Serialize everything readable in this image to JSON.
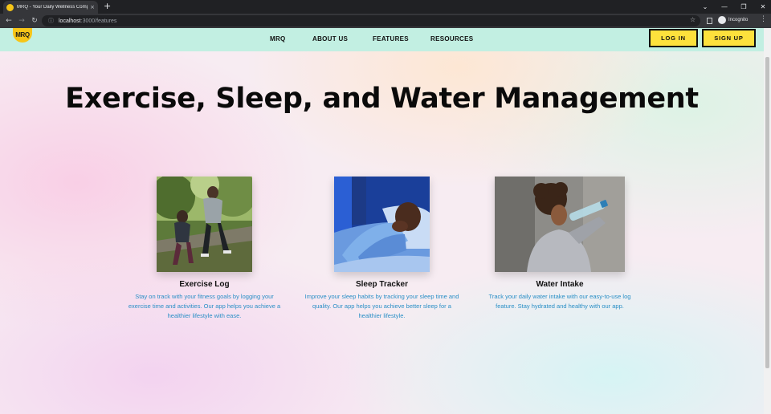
{
  "browser": {
    "tab_title": "MRQ - Your Daily Wellness Comp",
    "tab_close": "×",
    "new_tab": "+",
    "url_host": "localhost",
    "url_path": ":3000/features",
    "incognito_label": "Incognito",
    "window_controls": [
      "⌄",
      "—",
      "❐",
      "✕"
    ]
  },
  "nav": {
    "logo_text": "MRQ",
    "links": [
      "MRQ",
      "ABOUT US",
      "FEATURES",
      "RESOURCES"
    ],
    "login_label": "LOG IN",
    "signup_label": "SIGN UP"
  },
  "hero": {
    "title": "Exercise, Sleep, and Water Management"
  },
  "features": [
    {
      "title": "Exercise Log",
      "description": "Stay on track with your fitness goals by logging your exercise time and activities. Our app helps you achieve a healthier lifestyle with ease."
    },
    {
      "title": "Sleep Tracker",
      "description": "Improve your sleep habits by tracking your sleep time and quality. Our app helps you achieve better sleep for a healthier lifestyle."
    },
    {
      "title": "Water Intake",
      "description": "Track your daily water intake with our easy-to-use log feature. Stay hydrated and healthy with our app."
    }
  ],
  "colors": {
    "nav_bg": "#c2efe2",
    "button_bg": "#fde13c",
    "description_text": "#2a8fc6"
  }
}
